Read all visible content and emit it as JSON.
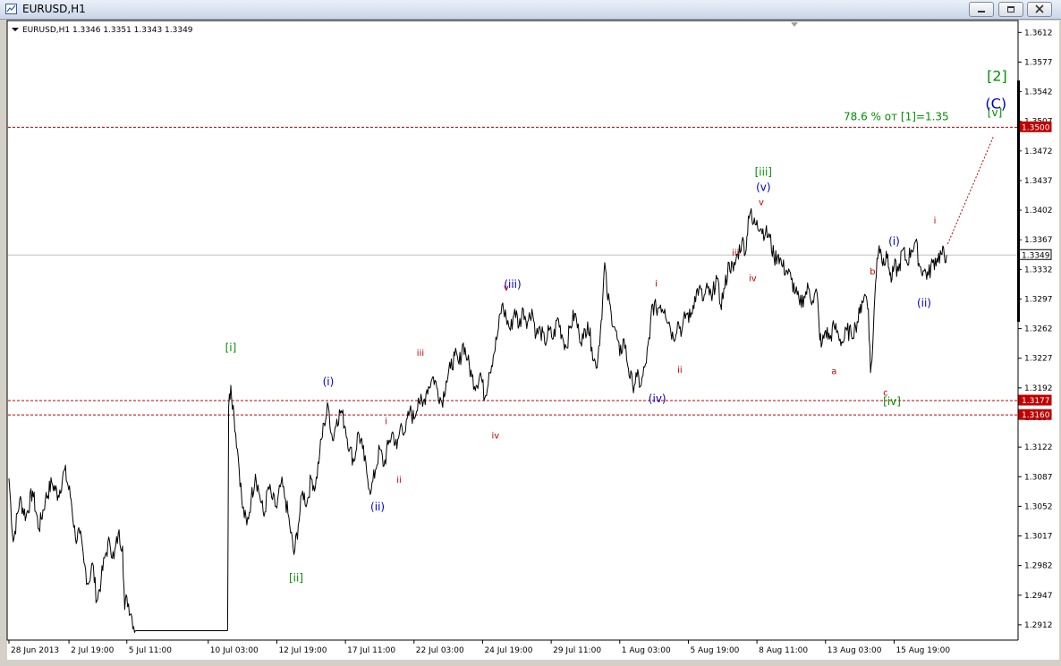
{
  "window": {
    "title": "EURUSD,H1",
    "icons": [
      "chart-window-icon",
      "minimize-icon",
      "restore-icon",
      "close-icon"
    ]
  },
  "chart_data": {
    "type": "line",
    "symbol_header": "EURUSD,H1  1.3346 1.3351 1.3343 1.3349",
    "ylim": [
      1.2895,
      1.3625
    ],
    "grid": false,
    "y_ticks": [
      "1.3612",
      "1.3577",
      "1.3542",
      "1.3507",
      "1.3472",
      "1.3437",
      "1.3402",
      "1.3367",
      "1.3332",
      "1.3297",
      "1.3262",
      "1.3227",
      "1.3192",
      "1.3157",
      "1.3122",
      "1.3087",
      "1.3052",
      "1.3017",
      "1.2982",
      "1.2947",
      "1.2912"
    ],
    "x_labels": [
      {
        "label": "28 Jun 2013",
        "bar": 0
      },
      {
        "label": "2 Jul 19:00",
        "bar": 56
      },
      {
        "label": "5 Jul 11:00",
        "bar": 110
      },
      {
        "label": "10 Jul 03:00",
        "bar": 186
      },
      {
        "label": "12 Jul 19:00",
        "bar": 250
      },
      {
        "label": "17 Jul 11:00",
        "bar": 314
      },
      {
        "label": "22 Jul 03:00",
        "bar": 378
      },
      {
        "label": "24 Jul 19:00",
        "bar": 442
      },
      {
        "label": "29 Jul 11:00",
        "bar": 506
      },
      {
        "label": "1 Aug 03:00",
        "bar": 570
      },
      {
        "label": "5 Aug 19:00",
        "bar": 634
      },
      {
        "label": "8 Aug 11:00",
        "bar": 698
      },
      {
        "label": "13 Aug 03:00",
        "bar": 762
      },
      {
        "label": "15 Aug 19:00",
        "bar": 826
      }
    ],
    "last_bar": 875,
    "anchors": [
      [
        0,
        1.3085
      ],
      [
        4,
        1.301
      ],
      [
        10,
        1.306
      ],
      [
        16,
        1.304
      ],
      [
        22,
        1.307
      ],
      [
        28,
        1.3025
      ],
      [
        34,
        1.306
      ],
      [
        40,
        1.308
      ],
      [
        46,
        1.3065
      ],
      [
        52,
        1.3095
      ],
      [
        58,
        1.306
      ],
      [
        62,
        1.3015
      ],
      [
        66,
        1.302
      ],
      [
        70,
        1.2985
      ],
      [
        74,
        1.296
      ],
      [
        78,
        1.2985
      ],
      [
        82,
        1.294
      ],
      [
        86,
        1.2965
      ],
      [
        90,
        1.2995
      ],
      [
        94,
        1.301
      ],
      [
        98,
        1.299
      ],
      [
        102,
        1.302
      ],
      [
        106,
        1.3005
      ],
      [
        108,
        1.293
      ],
      [
        110,
        1.2945
      ],
      [
        114,
        1.2925
      ],
      [
        118,
        1.2905
      ],
      [
        204,
        1.2905
      ],
      [
        205,
        1.317
      ],
      [
        207,
        1.3195
      ],
      [
        210,
        1.316
      ],
      [
        214,
        1.311
      ],
      [
        218,
        1.305
      ],
      [
        222,
        1.303
      ],
      [
        226,
        1.306
      ],
      [
        230,
        1.309
      ],
      [
        234,
        1.3065
      ],
      [
        238,
        1.304
      ],
      [
        242,
        1.3075
      ],
      [
        246,
        1.306
      ],
      [
        250,
        1.305
      ],
      [
        254,
        1.308
      ],
      [
        258,
        1.306
      ],
      [
        262,
        1.303
      ],
      [
        266,
        1.2995
      ],
      [
        270,
        1.303
      ],
      [
        274,
        1.307
      ],
      [
        278,
        1.3055
      ],
      [
        282,
        1.3085
      ],
      [
        286,
        1.3075
      ],
      [
        290,
        1.3115
      ],
      [
        294,
        1.315
      ],
      [
        298,
        1.317
      ],
      [
        302,
        1.313
      ],
      [
        306,
        1.3155
      ],
      [
        310,
        1.3165
      ],
      [
        314,
        1.3145
      ],
      [
        318,
        1.312
      ],
      [
        322,
        1.3105
      ],
      [
        326,
        1.314
      ],
      [
        330,
        1.312
      ],
      [
        334,
        1.309
      ],
      [
        338,
        1.307
      ],
      [
        342,
        1.3095
      ],
      [
        346,
        1.312
      ],
      [
        350,
        1.31
      ],
      [
        354,
        1.3125
      ],
      [
        358,
        1.314
      ],
      [
        362,
        1.312
      ],
      [
        366,
        1.315
      ],
      [
        370,
        1.314
      ],
      [
        374,
        1.3165
      ],
      [
        378,
        1.3155
      ],
      [
        382,
        1.318
      ],
      [
        386,
        1.317
      ],
      [
        390,
        1.319
      ],
      [
        394,
        1.32
      ],
      [
        396,
        1.3205
      ],
      [
        400,
        1.319
      ],
      [
        404,
        1.3175
      ],
      [
        408,
        1.32
      ],
      [
        412,
        1.3215
      ],
      [
        416,
        1.323
      ],
      [
        420,
        1.322
      ],
      [
        424,
        1.3245
      ],
      [
        428,
        1.3225
      ],
      [
        432,
        1.3205
      ],
      [
        436,
        1.3195
      ],
      [
        440,
        1.321
      ],
      [
        444,
        1.318
      ],
      [
        448,
        1.321
      ],
      [
        452,
        1.323
      ],
      [
        456,
        1.3255
      ],
      [
        460,
        1.329
      ],
      [
        464,
        1.3275
      ],
      [
        468,
        1.326
      ],
      [
        472,
        1.3285
      ],
      [
        476,
        1.3265
      ],
      [
        480,
        1.3285
      ],
      [
        484,
        1.327
      ],
      [
        488,
        1.3285
      ],
      [
        492,
        1.3255
      ],
      [
        496,
        1.326
      ],
      [
        500,
        1.3245
      ],
      [
        504,
        1.326
      ],
      [
        508,
        1.325
      ],
      [
        512,
        1.3275
      ],
      [
        516,
        1.3255
      ],
      [
        520,
        1.324
      ],
      [
        524,
        1.3265
      ],
      [
        528,
        1.328
      ],
      [
        532,
        1.3255
      ],
      [
        536,
        1.325
      ],
      [
        540,
        1.327
      ],
      [
        544,
        1.324
      ],
      [
        548,
        1.3215
      ],
      [
        552,
        1.326
      ],
      [
        554,
        1.3295
      ],
      [
        556,
        1.334
      ],
      [
        558,
        1.3305
      ],
      [
        562,
        1.328
      ],
      [
        566,
        1.326
      ],
      [
        570,
        1.323
      ],
      [
        574,
        1.325
      ],
      [
        578,
        1.3215
      ],
      [
        582,
        1.3195
      ],
      [
        586,
        1.3205
      ],
      [
        590,
        1.3195
      ],
      [
        594,
        1.322
      ],
      [
        598,
        1.325
      ],
      [
        600,
        1.329
      ],
      [
        604,
        1.3285
      ],
      [
        608,
        1.329
      ],
      [
        612,
        1.3285
      ],
      [
        616,
        1.327
      ],
      [
        620,
        1.325
      ],
      [
        624,
        1.327
      ],
      [
        628,
        1.326
      ],
      [
        632,
        1.328
      ],
      [
        636,
        1.3275
      ],
      [
        640,
        1.33
      ],
      [
        644,
        1.331
      ],
      [
        648,
        1.3295
      ],
      [
        652,
        1.331
      ],
      [
        656,
        1.3295
      ],
      [
        660,
        1.3325
      ],
      [
        664,
        1.329
      ],
      [
        668,
        1.331
      ],
      [
        672,
        1.334
      ],
      [
        676,
        1.333
      ],
      [
        680,
        1.335
      ],
      [
        684,
        1.3365
      ],
      [
        688,
        1.3355
      ],
      [
        690,
        1.3395
      ],
      [
        692,
        1.34
      ],
      [
        694,
        1.3385
      ],
      [
        698,
        1.339
      ],
      [
        702,
        1.338
      ],
      [
        706,
        1.3375
      ],
      [
        710,
        1.337
      ],
      [
        714,
        1.3345
      ],
      [
        718,
        1.335
      ],
      [
        722,
        1.3335
      ],
      [
        726,
        1.333
      ],
      [
        730,
        1.332
      ],
      [
        734,
        1.3305
      ],
      [
        738,
        1.329
      ],
      [
        742,
        1.33
      ],
      [
        746,
        1.331
      ],
      [
        750,
        1.3295
      ],
      [
        754,
        1.3305
      ],
      [
        756,
        1.3265
      ],
      [
        758,
        1.324
      ],
      [
        762,
        1.326
      ],
      [
        766,
        1.325
      ],
      [
        770,
        1.3265
      ],
      [
        774,
        1.3255
      ],
      [
        778,
        1.3245
      ],
      [
        782,
        1.326
      ],
      [
        786,
        1.3255
      ],
      [
        790,
        1.3265
      ],
      [
        794,
        1.328
      ],
      [
        796,
        1.3295
      ],
      [
        798,
        1.33
      ],
      [
        800,
        1.33
      ],
      [
        802,
        1.3285
      ],
      [
        804,
        1.321
      ],
      [
        806,
        1.324
      ],
      [
        808,
        1.33
      ],
      [
        810,
        1.3345
      ],
      [
        812,
        1.336
      ],
      [
        814,
        1.335
      ],
      [
        816,
        1.3345
      ],
      [
        818,
        1.334
      ],
      [
        820,
        1.335
      ],
      [
        822,
        1.3325
      ],
      [
        824,
        1.332
      ],
      [
        826,
        1.3335
      ],
      [
        830,
        1.333
      ],
      [
        834,
        1.3355
      ],
      [
        838,
        1.334
      ],
      [
        842,
        1.3355
      ],
      [
        846,
        1.3365
      ],
      [
        850,
        1.3335
      ],
      [
        854,
        1.333
      ],
      [
        858,
        1.3325
      ],
      [
        862,
        1.334
      ],
      [
        866,
        1.3345
      ],
      [
        870,
        1.335
      ],
      [
        875,
        1.3349
      ]
    ],
    "horizontal_lines": [
      {
        "price": 1.35,
        "label": "1.3500",
        "style": "dashed",
        "color": "#c00000",
        "tag": true
      },
      {
        "price": 1.3177,
        "label": "1.3177",
        "style": "dashed",
        "color": "#c00000",
        "tag": true
      },
      {
        "price": 1.316,
        "label": "1.3160",
        "style": "dashed",
        "color": "#c00000",
        "tag": true
      },
      {
        "price": 1.3349,
        "label": "1.3349",
        "style": "solid",
        "color": "#c0c0c0",
        "tag": false
      }
    ],
    "projection": {
      "from": [
        876,
        1.3362
      ],
      "to": [
        919,
        1.349
      ],
      "color": "#c00000"
    },
    "annotations": [
      {
        "text": "[i]",
        "bar": 207,
        "price": 1.3235,
        "color": "#009000",
        "size": 12
      },
      {
        "text": "[ii]",
        "bar": 268,
        "price": 1.2963,
        "color": "#009000",
        "size": 12
      },
      {
        "text": "[iii]",
        "bar": 704,
        "price": 1.3443,
        "color": "#009000",
        "size": 12
      },
      {
        "text": "[iv]",
        "bar": 824,
        "price": 1.3172,
        "color": "#009000",
        "size": 12
      },
      {
        "text": "[v]",
        "bar": 920,
        "price": 1.3513,
        "color": "#009000",
        "size": 12
      },
      {
        "text": "[2]",
        "bar": 922,
        "price": 1.3555,
        "color": "#009000",
        "size": 16
      },
      {
        "text": "(C)",
        "bar": 921,
        "price": 1.3522,
        "color": "#0000c0",
        "size": 16
      },
      {
        "text": "(i)",
        "bar": 298,
        "price": 1.3195,
        "color": "#0000c0",
        "size": 12
      },
      {
        "text": "(ii)",
        "bar": 344,
        "price": 1.3047,
        "color": "#0000c0",
        "size": 12
      },
      {
        "text": "(iii)",
        "bar": 470,
        "price": 1.331,
        "color": "#0000c0",
        "size": 12
      },
      {
        "text": "(iv)",
        "bar": 605,
        "price": 1.3175,
        "color": "#0000c0",
        "size": 12
      },
      {
        "text": "(v)",
        "bar": 704,
        "price": 1.3425,
        "color": "#0000c0",
        "size": 12
      },
      {
        "text": "(i)",
        "bar": 826,
        "price": 1.3361,
        "color": "#0000c0",
        "size": 12
      },
      {
        "text": "(ii)",
        "bar": 854,
        "price": 1.3288,
        "color": "#0000c0",
        "size": 12
      },
      {
        "text": "i",
        "bar": 352,
        "price": 1.3149,
        "color": "#c00000",
        "size": 10
      },
      {
        "text": "ii",
        "bar": 364,
        "price": 1.308,
        "color": "#c00000",
        "size": 10
      },
      {
        "text": "iii",
        "bar": 384,
        "price": 1.323,
        "color": "#c00000",
        "size": 10
      },
      {
        "text": "iv",
        "bar": 454,
        "price": 1.3132,
        "color": "#c00000",
        "size": 10
      },
      {
        "text": "v",
        "bar": 464,
        "price": 1.3307,
        "color": "#c00000",
        "size": 10
      },
      {
        "text": "i",
        "bar": 604,
        "price": 1.3312,
        "color": "#c00000",
        "size": 10
      },
      {
        "text": "ii",
        "bar": 626,
        "price": 1.321,
        "color": "#c00000",
        "size": 10
      },
      {
        "text": "iii",
        "bar": 678,
        "price": 1.3348,
        "color": "#c00000",
        "size": 10
      },
      {
        "text": "iv",
        "bar": 694,
        "price": 1.3318,
        "color": "#c00000",
        "size": 10
      },
      {
        "text": "v",
        "bar": 702,
        "price": 1.3408,
        "color": "#c00000",
        "size": 10
      },
      {
        "text": "a",
        "bar": 770,
        "price": 1.3208,
        "color": "#c00000",
        "size": 10
      },
      {
        "text": "b",
        "bar": 806,
        "price": 1.3326,
        "color": "#c00000",
        "size": 10
      },
      {
        "text": "c",
        "bar": 818,
        "price": 1.3183,
        "color": "#c00000",
        "size": 10
      },
      {
        "text": "i",
        "bar": 864,
        "price": 1.3386,
        "color": "#c00000",
        "size": 10
      },
      {
        "text": "78.6 % от [1]=1.35",
        "bar": 828,
        "price": 1.3508,
        "color": "#009000",
        "size": 12
      }
    ]
  }
}
